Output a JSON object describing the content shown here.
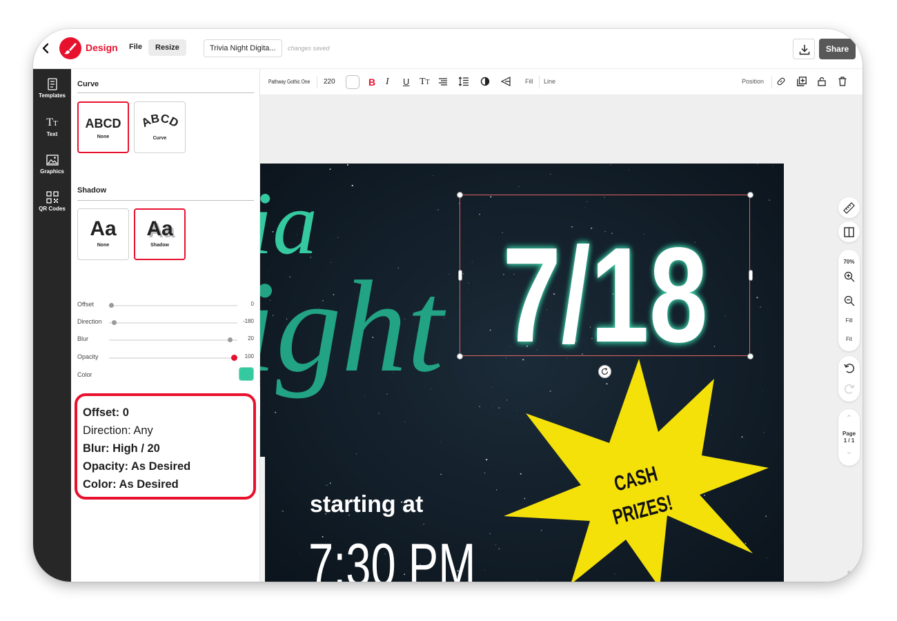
{
  "app": {
    "name": "Design",
    "brand_color": "#e8112d"
  },
  "topbar": {
    "menu_file": "File",
    "menu_resize": "Resize",
    "doc_title": "Trivia Night Digita...",
    "save_status": "changes saved",
    "share_label": "Share"
  },
  "rail": {
    "items": [
      {
        "label": "Templates",
        "icon": "templates-icon"
      },
      {
        "label": "Text",
        "icon": "text-icon"
      },
      {
        "label": "Graphics",
        "icon": "graphics-icon"
      },
      {
        "label": "QR Codes",
        "icon": "qr-code-icon"
      }
    ]
  },
  "panel": {
    "curve": {
      "heading": "Curve",
      "options": [
        {
          "preview": "ABCD",
          "label": "None",
          "selected": true
        },
        {
          "preview": "ABCD",
          "label": "Curve",
          "selected": false
        }
      ]
    },
    "shadow": {
      "heading": "Shadow",
      "options": [
        {
          "preview": "Aa",
          "label": "None",
          "selected": false
        },
        {
          "preview": "Aa",
          "label": "Shadow",
          "selected": true
        }
      ],
      "sliders": [
        {
          "label": "Offset",
          "value": "0",
          "fraction": 0.0
        },
        {
          "label": "Direction",
          "value": "-180",
          "fraction": 0.02
        },
        {
          "label": "Blur",
          "value": "20",
          "fraction": 0.96
        },
        {
          "label": "Opacity",
          "value": "100",
          "fraction": 1.0
        }
      ],
      "color_label": "Color",
      "color_value": "#35c9a0"
    },
    "callout": {
      "lines": [
        {
          "text": "Offset: 0",
          "bold": true
        },
        {
          "text": "Direction: Any",
          "bold": false
        },
        {
          "text": "Blur: High / 20",
          "bold": true
        },
        {
          "text": "Opacity: As Desired",
          "bold": true
        },
        {
          "text": "Color: As Desired",
          "bold": true
        }
      ]
    }
  },
  "format_toolbar": {
    "font": "Pathway Gothic One",
    "size": "220",
    "fill_label": "Fill",
    "line_label": "Line",
    "position_label": "Position"
  },
  "right_tools": {
    "zoom": "70%",
    "fill_label": "Fill",
    "fit_label": "Fit",
    "page_label": "Page",
    "page_count": "1 / 1"
  },
  "flyer": {
    "script_line1": "ia",
    "script_line2": "ight",
    "date": "7/18",
    "starburst_line1": "CASH",
    "starburst_line2": "PRIZES!",
    "subtitle": "starting at",
    "time": "7:30 PM",
    "accent_color": "#2bb79a",
    "starburst_color": "#f5e10a"
  }
}
